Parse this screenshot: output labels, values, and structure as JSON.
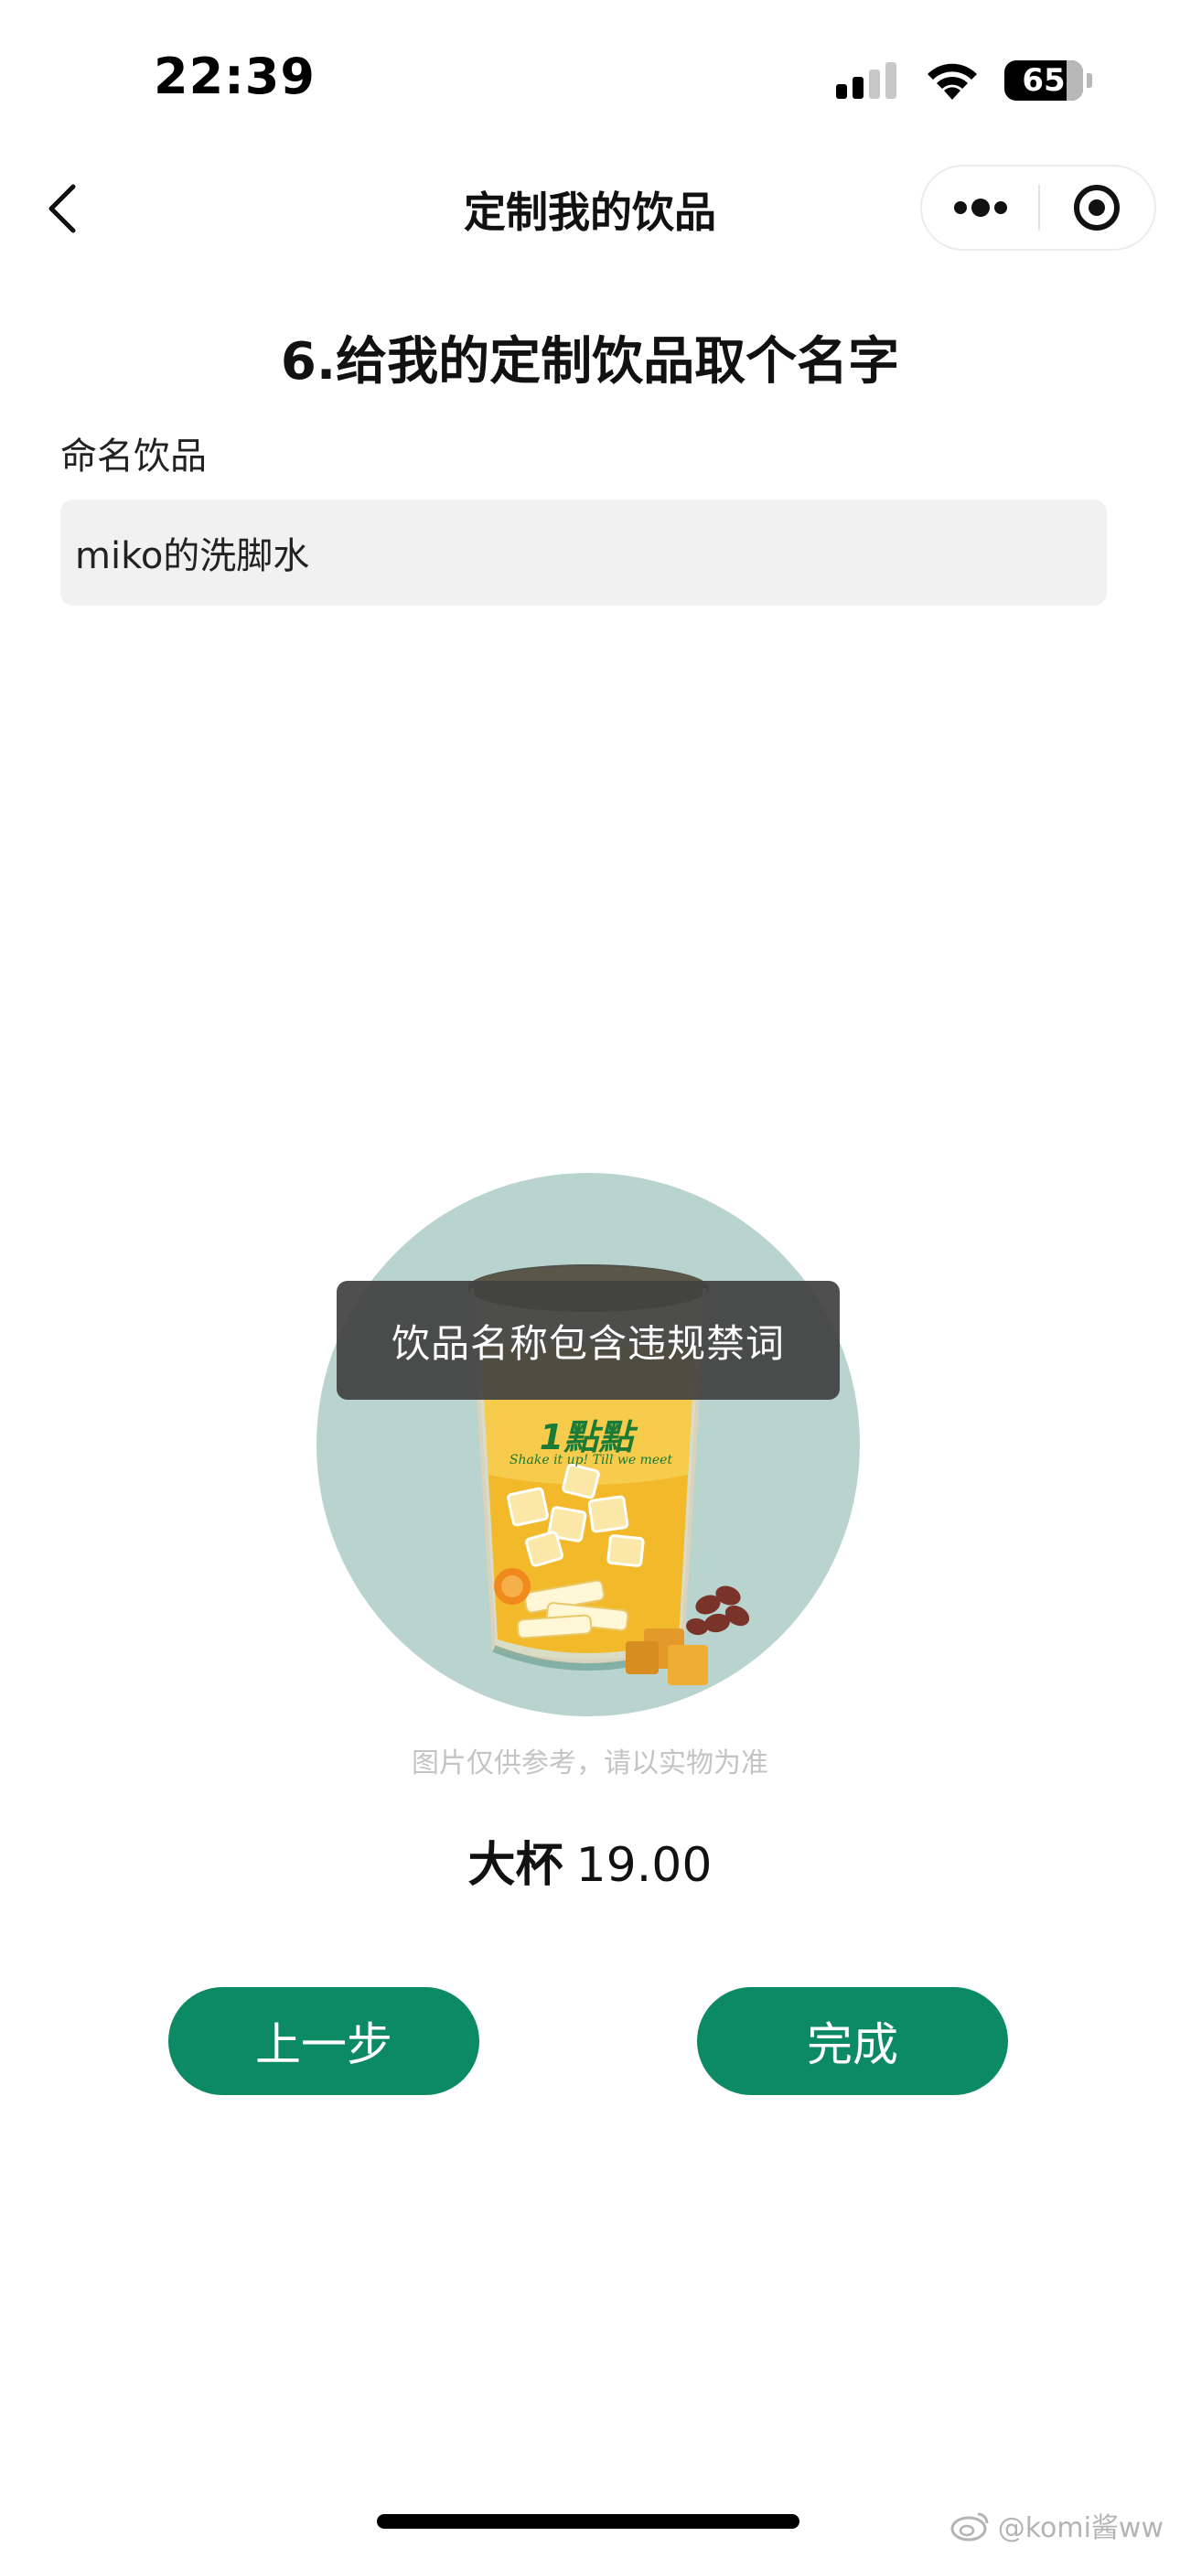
{
  "status_bar": {
    "time": "22:39",
    "battery": "65",
    "icons": [
      "signal-icon",
      "wifi-icon",
      "battery-icon"
    ]
  },
  "nav": {
    "title": "定制我的饮品",
    "back_icon": "chevron-left-icon",
    "more_icon": "more-dots-icon",
    "close_icon": "target-close-icon"
  },
  "step": {
    "title": "6.给我的定制饮品取个名字"
  },
  "form": {
    "label": "命名饮品",
    "name_value": "miko的洗脚水"
  },
  "drink": {
    "brand": "1點點",
    "slogan": "Shake it up! Till we meet",
    "circle_color": "#b9d3cf"
  },
  "toast": {
    "text": "饮品名称包含违规禁词"
  },
  "disclaimer": "图片仅供参考，请以实物为准",
  "price": {
    "size": "大杯",
    "value": "19.00"
  },
  "buttons": {
    "prev": "上一步",
    "done": "完成"
  },
  "watermark": "@komi酱ww",
  "colors": {
    "accent": "#0c8a63",
    "toast_bg": "#424242",
    "brand_green": "#1b7a35"
  }
}
